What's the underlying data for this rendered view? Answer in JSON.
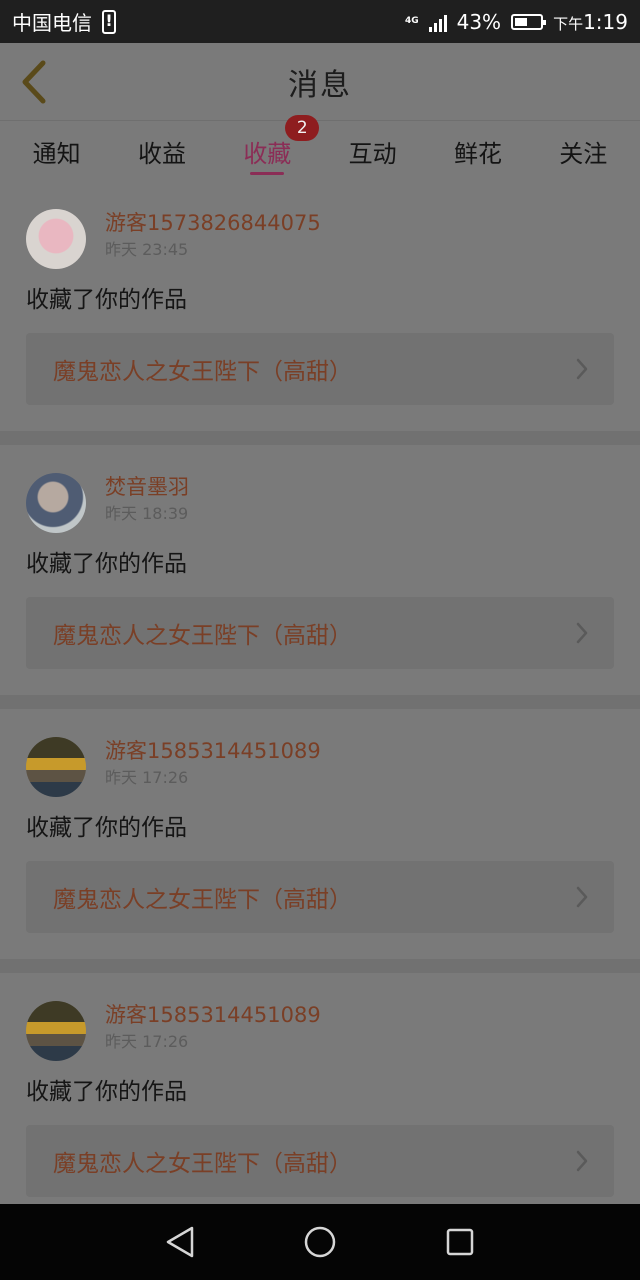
{
  "status_bar": {
    "carrier": "中国电信",
    "network": "4G",
    "battery": "43%",
    "time_prefix": "下午",
    "time": "1:19"
  },
  "header": {
    "title": "消息"
  },
  "tabs": [
    {
      "label": "通知"
    },
    {
      "label": "收益"
    },
    {
      "label": "收藏",
      "badge": "2",
      "active": true
    },
    {
      "label": "互动"
    },
    {
      "label": "鲜花"
    },
    {
      "label": "关注"
    }
  ],
  "messages": [
    {
      "username": "游客1573826844075",
      "time": "昨天 23:45",
      "action": "收藏了你的作品",
      "work": "魔鬼恋人之女王陛下（高甜）"
    },
    {
      "username": "焚音墨羽",
      "time": "昨天 18:39",
      "action": "收藏了你的作品",
      "work": "魔鬼恋人之女王陛下（高甜）"
    },
    {
      "username": "游客1585314451089",
      "time": "昨天 17:26",
      "action": "收藏了你的作品",
      "work": "魔鬼恋人之女王陛下（高甜）"
    },
    {
      "username": "游客1585314451089",
      "time": "昨天 17:26",
      "action": "收藏了你的作品",
      "work": "魔鬼恋人之女王陛下（高甜）"
    }
  ],
  "colors": {
    "accent": "#8b2d56",
    "badge": "#8e1d1f",
    "link_text": "#7a3f26",
    "overlay_bg": "#7a7a7a"
  }
}
